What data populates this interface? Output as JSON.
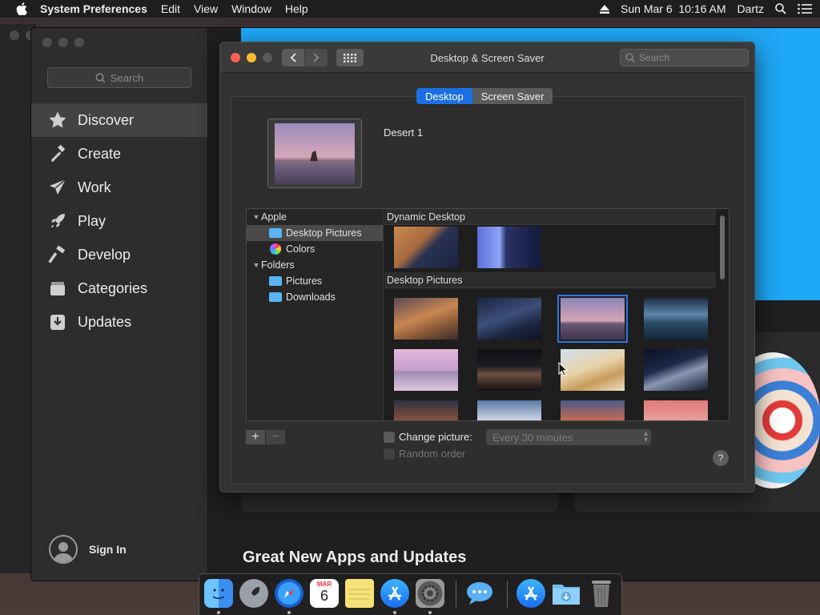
{
  "menubar": {
    "app_name": "System Preferences",
    "menus": [
      "Edit",
      "View",
      "Window",
      "Help"
    ],
    "datetime": "Sun Mar 6  10:16 AM",
    "user": "Dartz"
  },
  "appstore": {
    "search_placeholder": "Search",
    "nav": [
      {
        "label": "Discover",
        "icon": "star-icon",
        "active": true
      },
      {
        "label": "Create",
        "icon": "hammer-brush-icon",
        "active": false
      },
      {
        "label": "Work",
        "icon": "paper-plane-icon",
        "active": false
      },
      {
        "label": "Play",
        "icon": "rocket-icon",
        "active": false
      },
      {
        "label": "Develop",
        "icon": "hammer-icon",
        "active": false
      },
      {
        "label": "Categories",
        "icon": "stack-icon",
        "active": false
      },
      {
        "label": "Updates",
        "icon": "download-icon",
        "active": false
      }
    ],
    "sign_in": "Sign In",
    "section_heading": "Great New Apps and Updates"
  },
  "sysprefs": {
    "title": "Desktop & Screen Saver",
    "search_placeholder": "Search",
    "tabs": {
      "desktop": "Desktop",
      "screen_saver": "Screen Saver",
      "selected": "Desktop"
    },
    "current_picture": "Desert 1",
    "sources": {
      "apple_group": "Apple",
      "desktop_pictures": "Desktop Pictures",
      "colors": "Colors",
      "folders_group": "Folders",
      "pictures": "Pictures",
      "downloads": "Downloads"
    },
    "sections": {
      "dynamic": "Dynamic Desktop",
      "desktop_pictures": "Desktop Pictures"
    },
    "change_picture_label": "Change picture:",
    "change_picture_interval": "Every 30 minutes",
    "random_order_label": "Random order",
    "help_label": "?",
    "add_label": "+",
    "remove_label": "−"
  },
  "dock": {
    "calendar_month": "MAR",
    "calendar_day": "6"
  },
  "colors": {
    "accent": "#1c6fe2",
    "banner": "#1ea7f5",
    "close": "#fc5f57",
    "minimize": "#fdbc2e"
  }
}
